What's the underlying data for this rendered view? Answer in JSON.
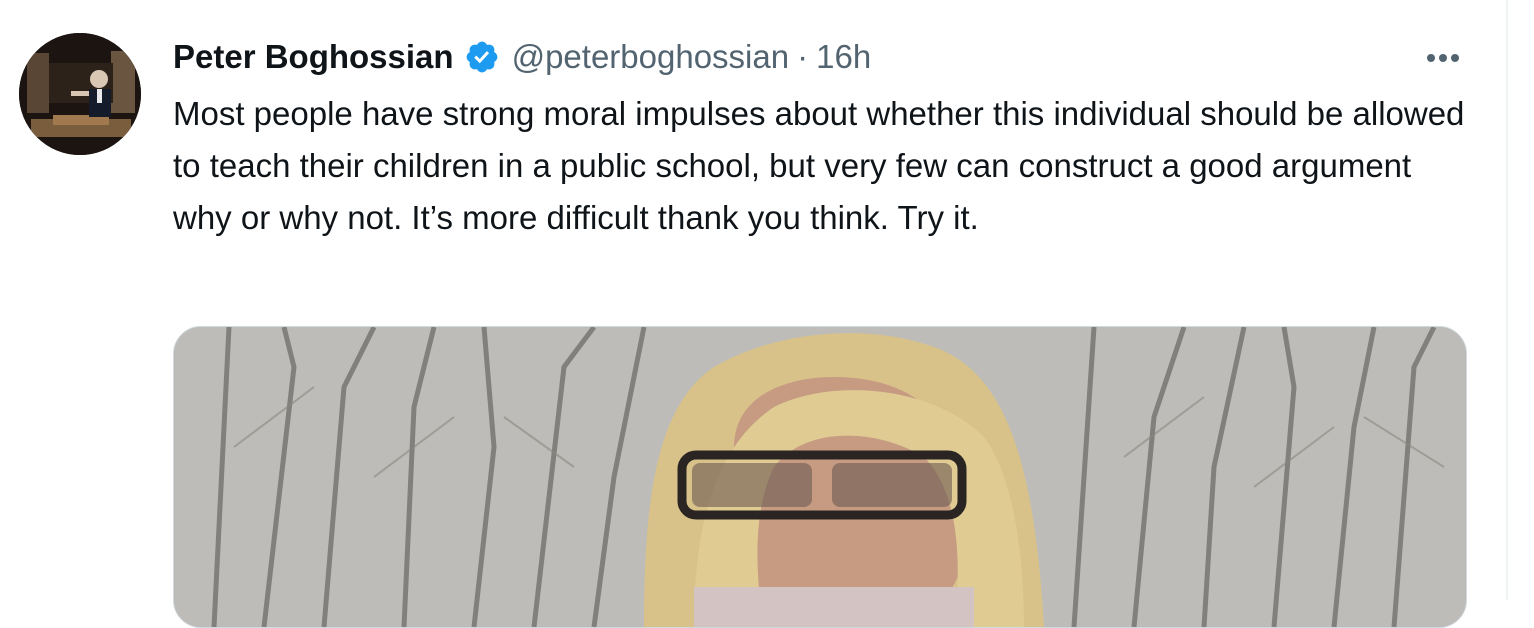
{
  "tweet": {
    "author_name": "Peter Boghossian",
    "handle": "@peterboghossian",
    "separator": "·",
    "time": "16h",
    "text": "Most people have strong moral impulses about whether this individual should be allowed to teach their children in a public school, but very few can construct a good argument why or why not. It’s more difficult thank you think. Try it."
  },
  "icons": {
    "verified": "verified-badge-icon",
    "more": "more-options-icon"
  },
  "colors": {
    "verified_blue": "#1d9bf0",
    "secondary_text": "#536471",
    "primary_text": "#0f1419"
  }
}
